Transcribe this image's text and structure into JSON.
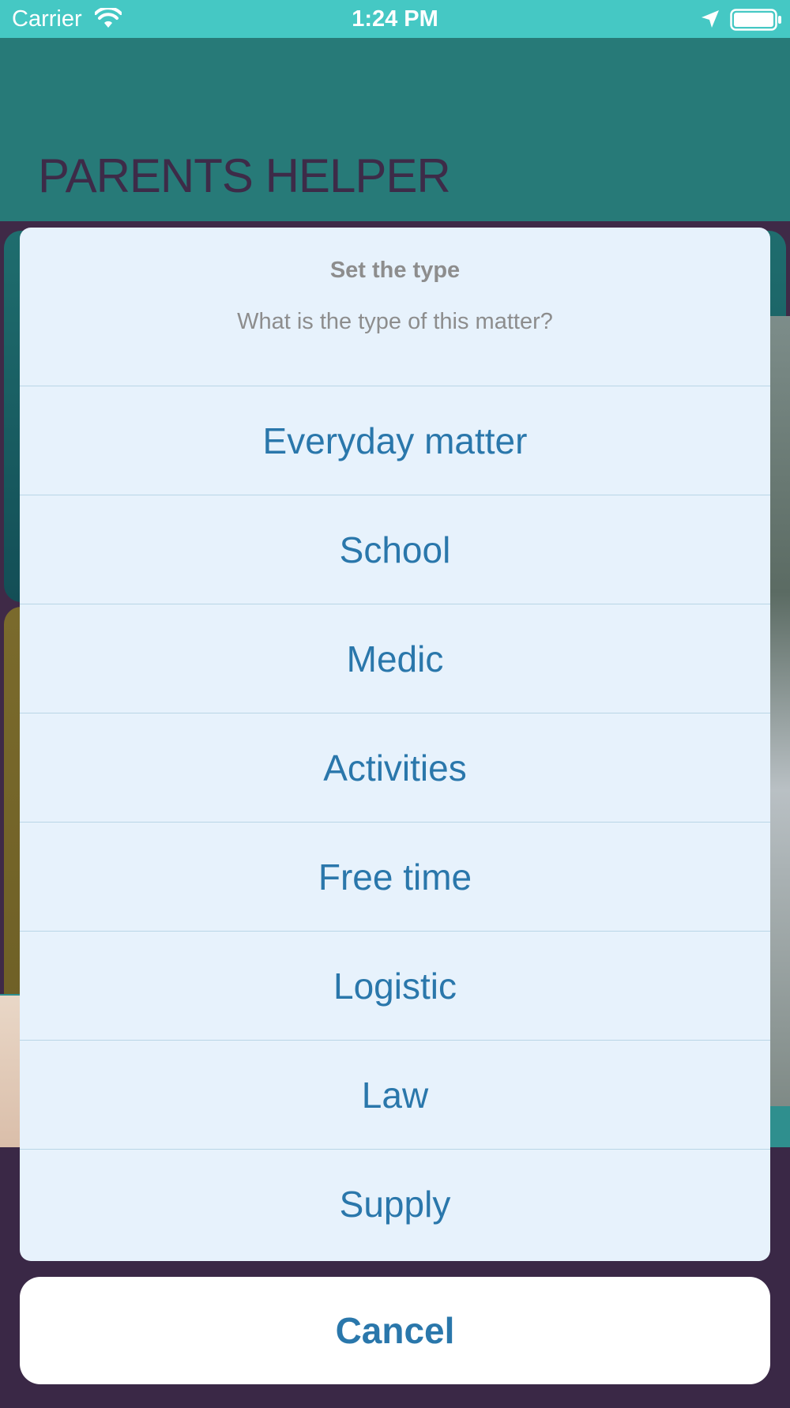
{
  "status_bar": {
    "carrier": "Carrier",
    "time": "1:24 PM",
    "icons": [
      "wifi-icon",
      "location-arrow-icon",
      "battery-icon"
    ]
  },
  "app": {
    "title": "PARENTS HELPER"
  },
  "action_sheet": {
    "title": "Set the type",
    "message": "What is the type of this matter?",
    "options": [
      "Everyday matter",
      "School",
      "Medic",
      "Activities",
      "Free time",
      "Logistic",
      "Law",
      "Supply"
    ],
    "cancel_label": "Cancel"
  },
  "colors": {
    "status_bar": "#45c8c4",
    "header": "#277a78",
    "title_text": "#3d2b48",
    "sheet_background": "#e7f2fc",
    "action_text": "#2a77ab",
    "muted_text": "#8d8d8d"
  }
}
